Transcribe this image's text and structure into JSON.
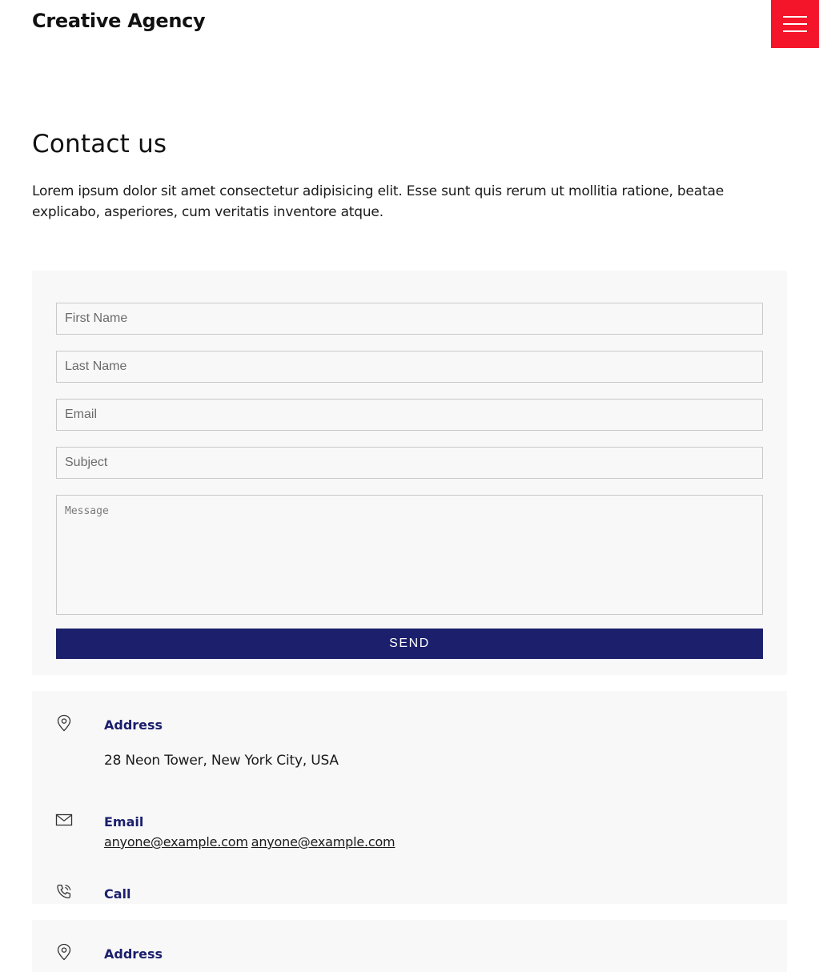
{
  "header": {
    "brand": "Creative Agency",
    "menu_icon": "hamburger-icon",
    "menu_color": "#f4152a"
  },
  "contact": {
    "title": "Contact us",
    "intro": "Lorem ipsum dolor sit amet consectetur adipisicing elit. Esse sunt quis rerum ut mollitia ratione, beatae explicabo, asperiores, cum veritatis inventore atque."
  },
  "form": {
    "first_name_placeholder": "First Name",
    "last_name_placeholder": "Last Name",
    "email_placeholder": "Email",
    "subject_placeholder": "Subject",
    "message_placeholder": "Message",
    "send_label": "SEND",
    "send_color": "#1b1f6c"
  },
  "info": {
    "address_label": "Address",
    "address_icon": "map-pin-icon",
    "address_text": "28 Neon Tower, New York City, USA",
    "email_label": "Email",
    "email_icon": "envelope-icon",
    "email_links": [
      "anyone@example.com",
      "anyone@example.com"
    ],
    "call_label": "Call",
    "call_icon": "phone-icon",
    "second_address_label": "Address"
  }
}
